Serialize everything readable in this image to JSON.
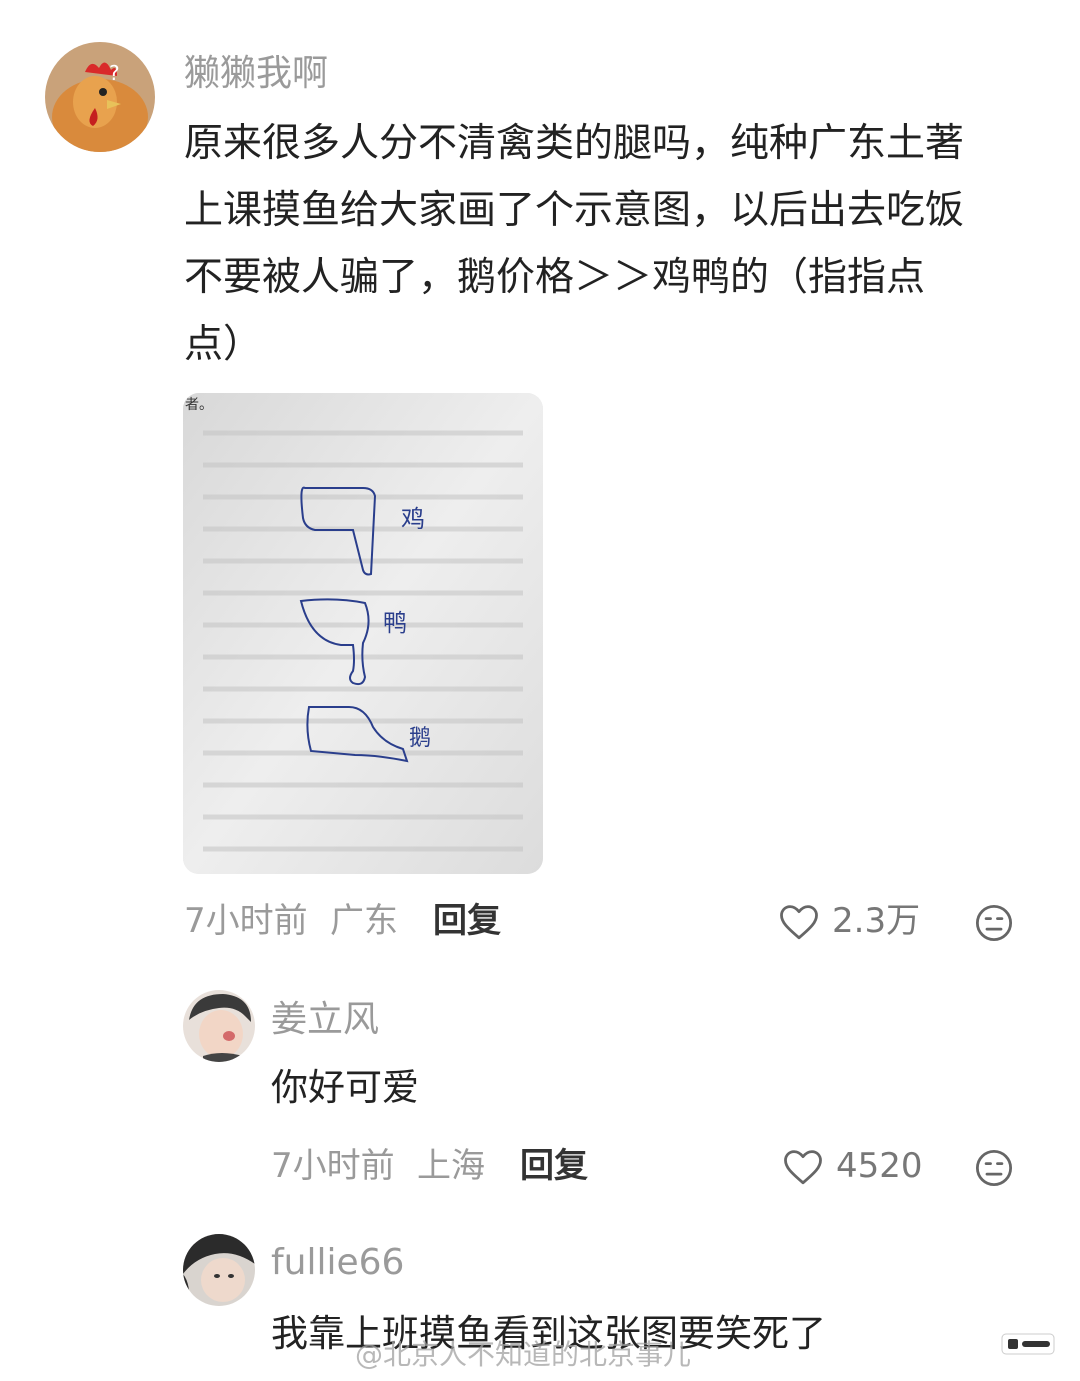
{
  "comment": {
    "username": "獭獭我啊",
    "text_lines": [
      "原来很多人分不清禽类的腿吗，纯种广东土著",
      "上课摸鱼给大家画了个示意图，以后出去吃饭",
      "不要被人骗了，鹅价格＞＞鸡鸭的（指指点",
      "点）"
    ],
    "photo": {
      "corner_text": "者。",
      "labels": [
        "鸡",
        "鸭",
        "鹅"
      ]
    },
    "time": "7小时前",
    "location": "广东",
    "reply_label": "回复",
    "likes": "2.3万",
    "avatar_icon": "chicken-avatar-icon"
  },
  "replies": [
    {
      "username": "姜立风",
      "text": "你好可爱",
      "time": "7小时前",
      "location": "上海",
      "reply_label": "回复",
      "likes": "4520"
    },
    {
      "username": "fullie66",
      "text": "我靠上班摸鱼看到这张图要笑死了"
    }
  ],
  "watermark": "@北京人不知道的北京事儿",
  "colors": {
    "username": "#9a9a9a",
    "text": "#222222",
    "meta": "#9a9a9a",
    "icon": "#666666",
    "photo_ink": "#2a3e8c"
  }
}
